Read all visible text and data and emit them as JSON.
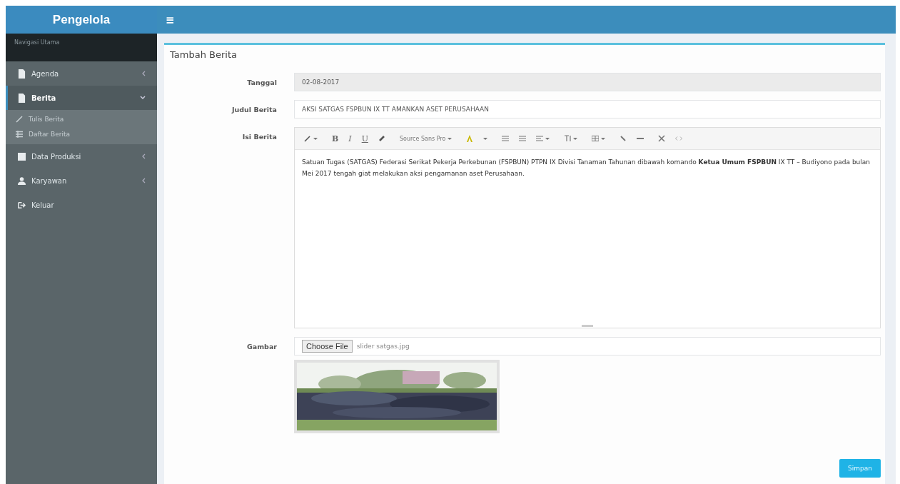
{
  "sidebar": {
    "brand": "Pengelola",
    "section_title": "Navigasi Utama",
    "items": [
      {
        "label": "Agenda",
        "selected": false,
        "expanded": false
      },
      {
        "label": "Berita",
        "selected": true,
        "expanded": true,
        "children": [
          {
            "label": "Tulis Berita"
          },
          {
            "label": "Daftar Berita"
          }
        ]
      },
      {
        "label": "Data Produksi",
        "selected": false,
        "expanded": false
      },
      {
        "label": "Karyawan",
        "selected": false,
        "expanded": false
      },
      {
        "label": "Keluar",
        "selected": false
      }
    ]
  },
  "topbar": {
    "menu_glyph": "≡"
  },
  "form": {
    "title": "Tambah Berita",
    "fields": [
      {
        "kind": "readonly",
        "label": "Tanggal",
        "value": "02-08-2017"
      },
      {
        "kind": "text",
        "label": "Judul Berita",
        "value": "AKSI SATGAS FSPBUN IX TT AMANKAN ASET PERUSAHAAN"
      },
      {
        "kind": "editor",
        "label": "Isi Berita",
        "toolbar": {
          "format_letters": [
            "B",
            "I",
            "U"
          ],
          "font_name": "Source Sans Pro"
        },
        "value": "Satuan Tugas (SATGAS) Federasi Serikat Pekerja Perkebunan (FSPBUN) PTPN IX Divisi Tanaman Tahunan dibawah komando **Ketua Umum FSPBUN** IX TT – Budiyono pada bulan Mei 2017 tengah giat melakukan aksi pengamanan aset Perusahaan."
      },
      {
        "kind": "file",
        "label": "Gambar",
        "button": "Choose File",
        "value": "slider satgas.jpg"
      }
    ],
    "submit": "Simpan"
  }
}
